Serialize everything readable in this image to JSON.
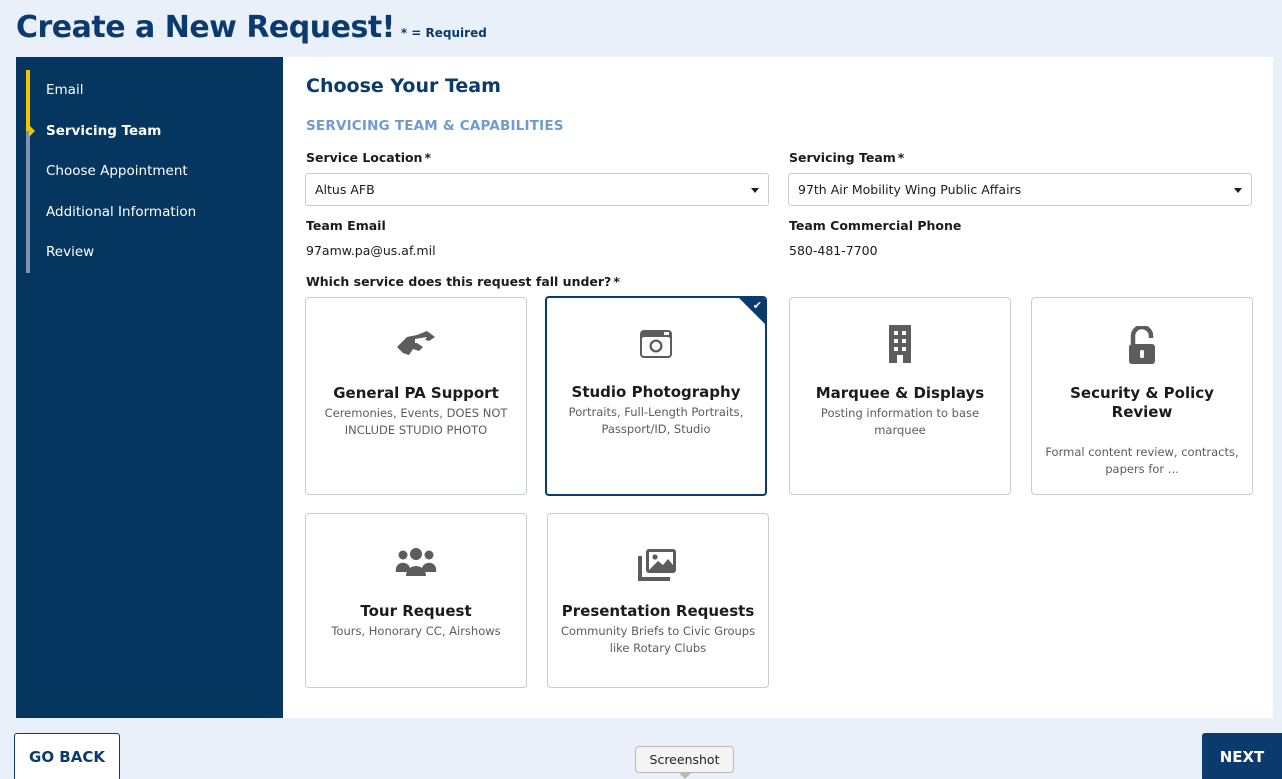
{
  "header": {
    "title": "Create a New Request!",
    "required_note": "* = Required"
  },
  "sidebar": {
    "steps": [
      {
        "label": "Email",
        "state": "done"
      },
      {
        "label": "Servicing Team",
        "state": "active"
      },
      {
        "label": "Choose Appointment",
        "state": "upcoming"
      },
      {
        "label": "Additional Information",
        "state": "upcoming"
      },
      {
        "label": "Review",
        "state": "upcoming"
      }
    ],
    "accent_color": "#f2c500"
  },
  "main": {
    "title": "Choose Your Team",
    "subtitle": "SERVICING TEAM & CAPABILITIES",
    "service_location": {
      "label": "Service Location",
      "value": "Altus AFB"
    },
    "servicing_team": {
      "label": "Servicing Team",
      "value": "97th Air Mobility Wing Public Affairs"
    },
    "team_email": {
      "label": "Team Email",
      "value": "97amw.pa@us.af.mil"
    },
    "team_phone": {
      "label": "Team Commercial Phone",
      "value": "580-481-7700"
    },
    "service_question": "Which service does this request fall under?",
    "required_star": "*",
    "services": [
      {
        "title": "General PA Support",
        "description": "Ceremonies, Events, DOES NOT INCLUDE STUDIO PHOTO",
        "icon": "handshake-icon",
        "selected": false
      },
      {
        "title": "Studio Photography",
        "description": "Portraits, Full-Length Portraits, Passport/ID, Studio",
        "icon": "camera-icon",
        "selected": true
      },
      {
        "title": "Marquee & Displays",
        "description": "Posting information to base marquee",
        "icon": "building-icon",
        "selected": false
      },
      {
        "title": "Security & Policy Review",
        "description": "Formal content review, contracts, papers for ...",
        "icon": "unlock-icon",
        "selected": false
      },
      {
        "title": "Tour Request",
        "description": "Tours, Honorary CC, Airshows",
        "icon": "users-icon",
        "selected": false
      },
      {
        "title": "Presentation Requests",
        "description": "Community Briefs to Civic Groups like Rotary Clubs",
        "icon": "images-icon",
        "selected": false
      }
    ]
  },
  "footer": {
    "back_label": "GO BACK",
    "next_label": "NEXT",
    "tooltip": "Screenshot"
  },
  "colors": {
    "brand_navy": "#0b3a6e",
    "sidebar_bg": "#04365f",
    "subtitle_blue": "#6f9bd0"
  }
}
